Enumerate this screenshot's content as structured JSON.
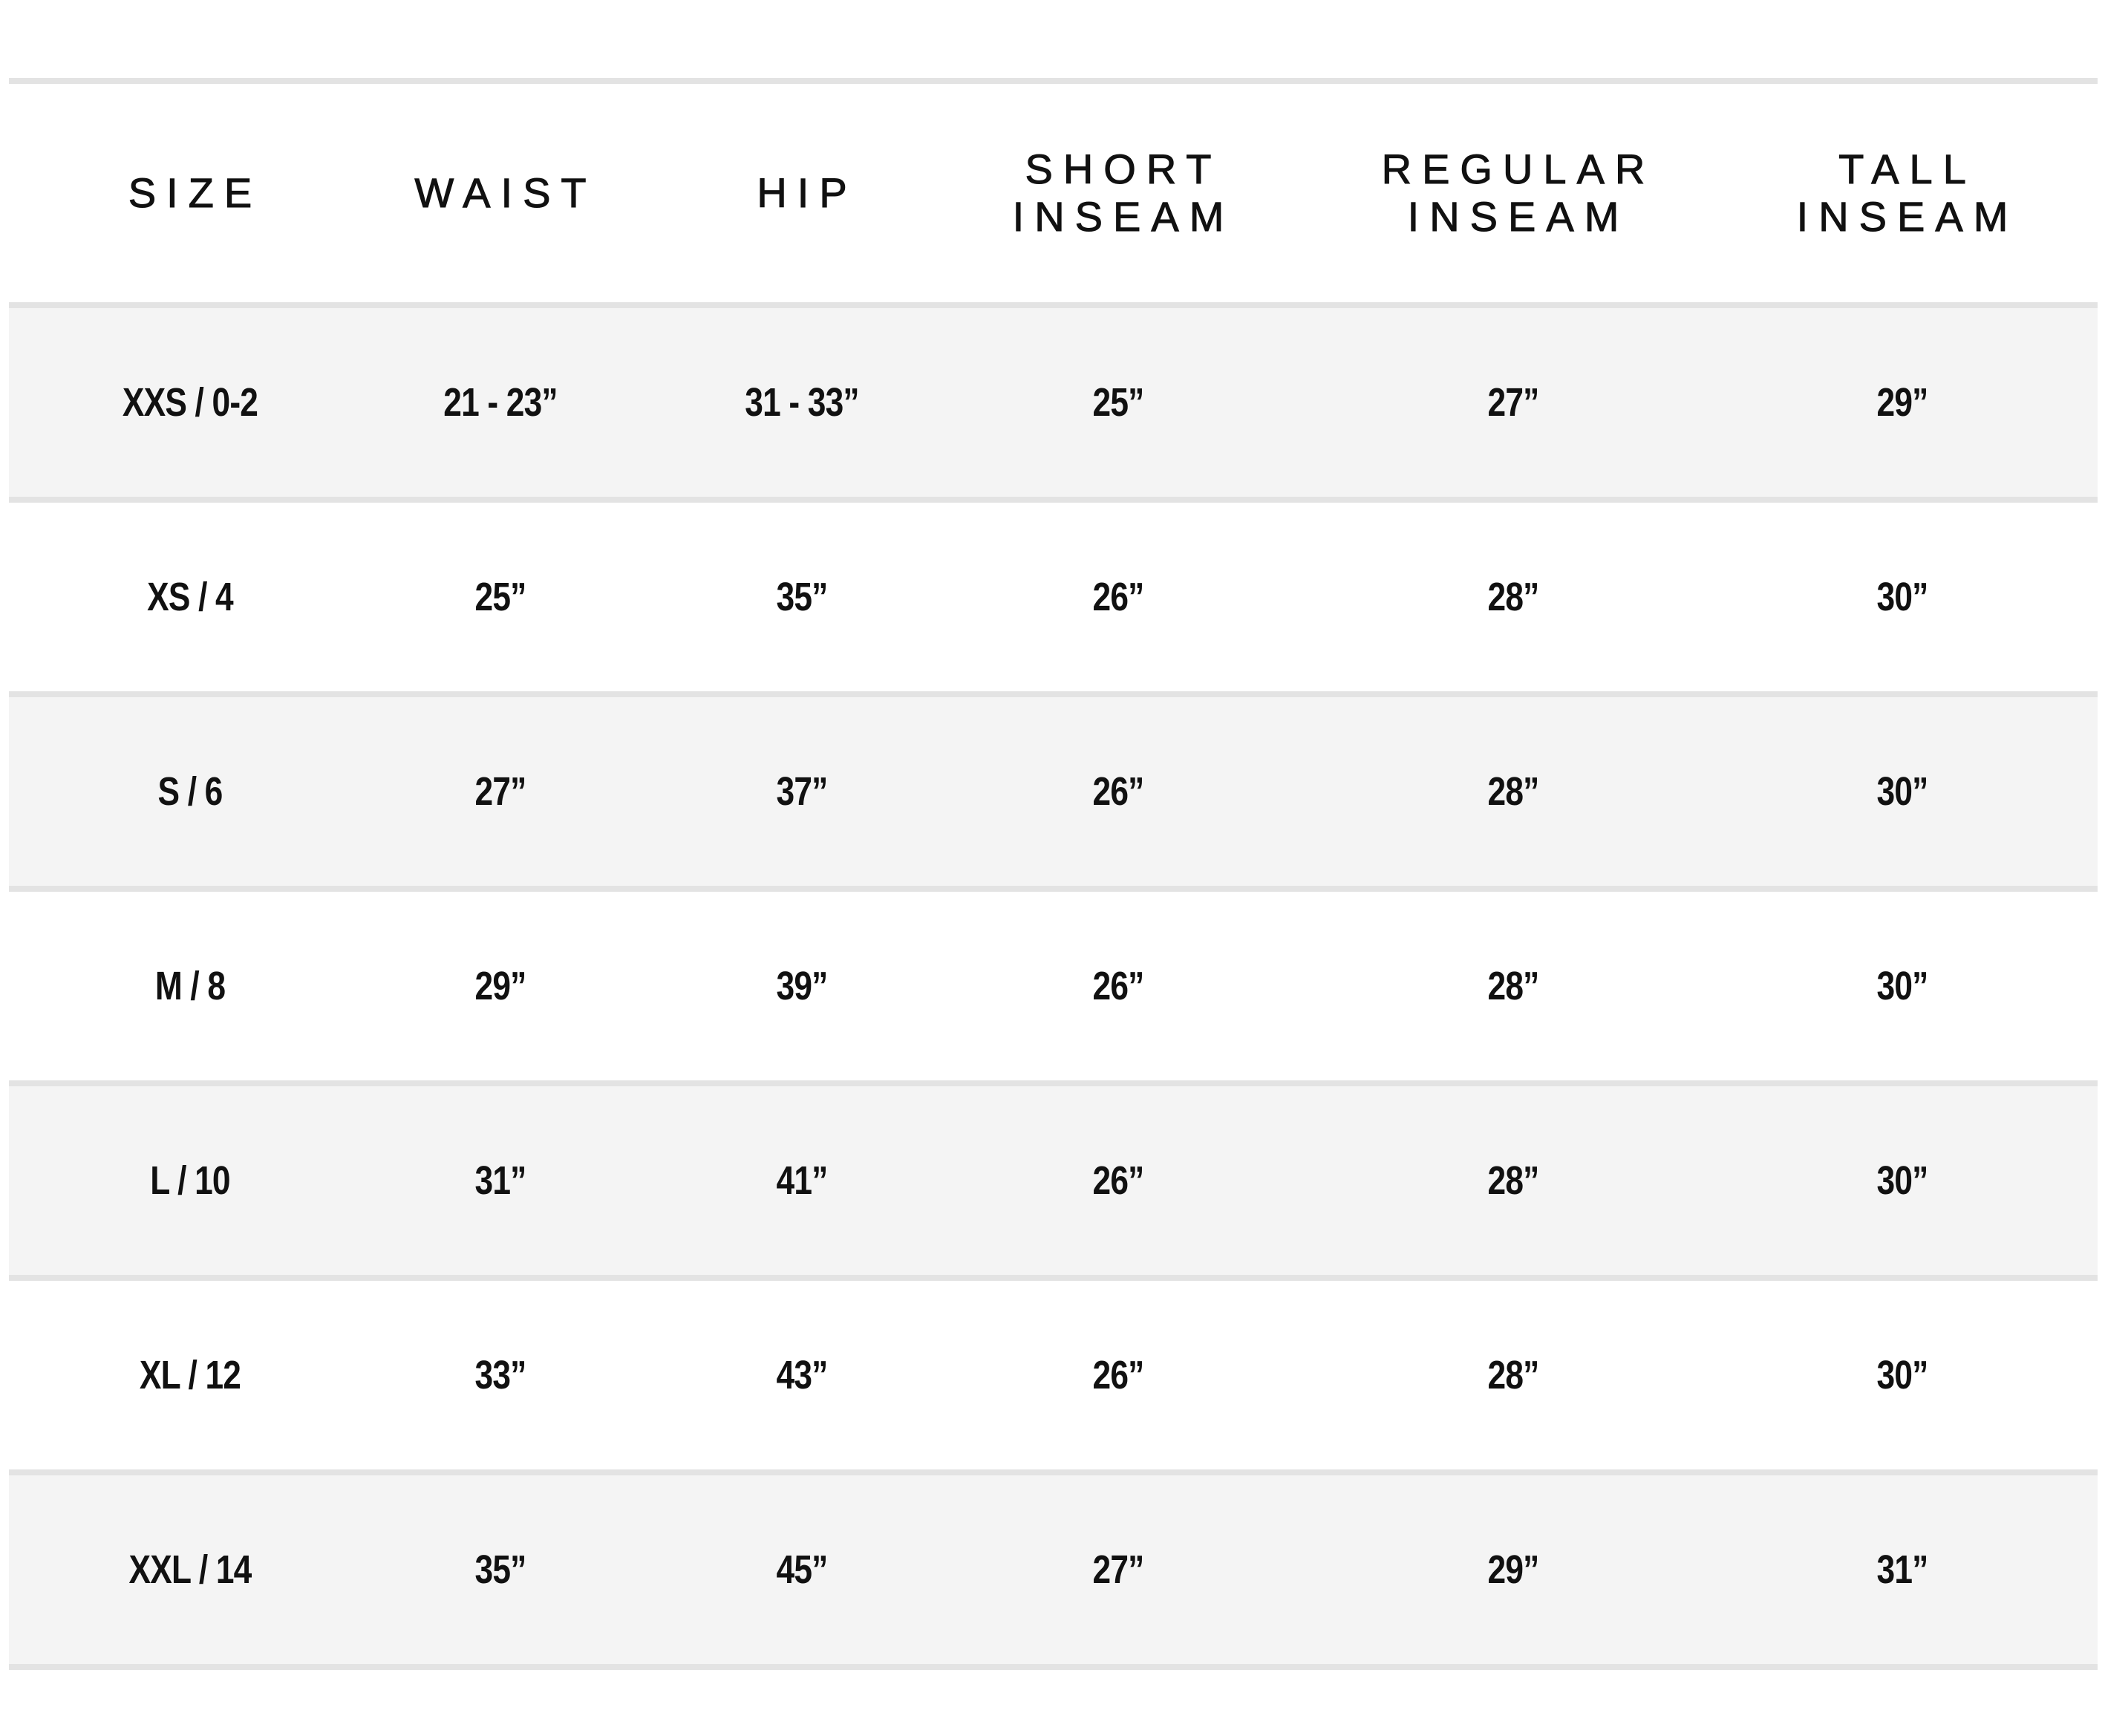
{
  "table": {
    "headers": [
      {
        "line1": "SIZE",
        "line2": ""
      },
      {
        "line1": "WAIST",
        "line2": ""
      },
      {
        "line1": "HIP",
        "line2": ""
      },
      {
        "line1": "SHORT",
        "line2": "INSEAM"
      },
      {
        "line1": "REGULAR",
        "line2": "INSEAM"
      },
      {
        "line1": "TALL",
        "line2": "INSEAM"
      }
    ],
    "rows": [
      [
        "XXS / 0-2",
        "21 - 23”",
        "31 - 33”",
        "25”",
        "27”",
        "29”"
      ],
      [
        "XS / 4",
        "25”",
        "35”",
        "26”",
        "28”",
        "30”"
      ],
      [
        "S / 6",
        "27”",
        "37”",
        "26”",
        "28”",
        "30”"
      ],
      [
        "M / 8",
        "29”",
        "39”",
        "26”",
        "28”",
        "30”"
      ],
      [
        "L / 10",
        "31”",
        "41”",
        "26”",
        "28”",
        "30”"
      ],
      [
        "XL / 12",
        "33”",
        "43”",
        "26”",
        "28”",
        "30”"
      ],
      [
        "XXL / 14",
        "35”",
        "45”",
        "27”",
        "29”",
        "31”"
      ]
    ]
  },
  "colors": {
    "divider": "#e3e3e3",
    "zebra": "#f4f4f4",
    "text": "#111111"
  }
}
